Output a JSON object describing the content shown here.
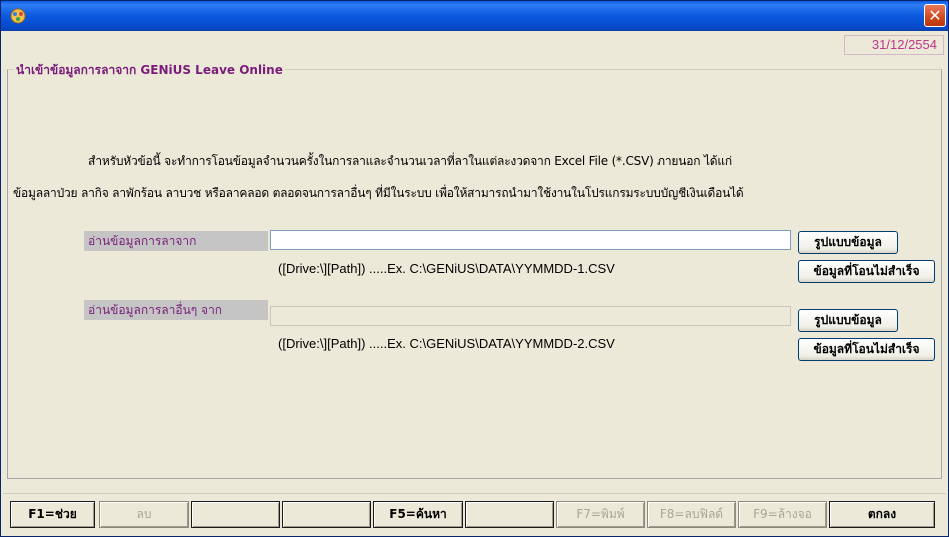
{
  "window": {
    "title": "",
    "title_bar_color": "#0a58de"
  },
  "date": "31/12/2554",
  "group": {
    "title": "นำเข้าข้อมูลการลาจาก GENiUS Leave Online"
  },
  "description": {
    "line1": "สำหรับหัวข้อนี้ จะทำการโอนข้อมูลจำนวนครั้งในการลาและจำนวนเวลาที่ลาในแต่ละงวดจาก Excel File (*.CSV) ภายนอก ได้แก่",
    "line2": "ข้อมูลลาป่วย ลากิจ ลาพักร้อน ลาบวช หรือลาคลอด ตลอดจนการลาอื่นๆ ที่มีในระบบ   เพื่อให้สามารถนำมาใช้งานในโปรแกรมระบบบัญชีเงินเดือนได้"
  },
  "leave_read": {
    "label": "อ่านข้อมูลการลาจาก",
    "value": "",
    "hint": "([Drive:\\][Path]) .....Ex. C:\\GENiUS\\DATA\\YYMMDD-1.CSV",
    "format_button": "รูปแบบข้อมูล",
    "failed_button": "ข้อมูลที่โอนไม่สำเร็จ"
  },
  "other_leave_read": {
    "label": "อ่านข้อมูลการลาอื่นๆ จาก",
    "value": "",
    "hint": "([Drive:\\][Path]) .....Ex. C:\\GENiUS\\DATA\\YYMMDD-2.CSV",
    "format_button": "รูปแบบข้อมูล",
    "failed_button": "ข้อมูลที่โอนไม่สำเร็จ"
  },
  "toolbar": {
    "f1": "F1=ช่วย",
    "delete": "ลบ",
    "blank1": "",
    "blank2": "",
    "f5": "F5=ค้นหา",
    "blank3": "",
    "f7": "F7=พิมพ์",
    "f8": "F8=ลบฟิลด์",
    "f9": "F9=ล้างจอ",
    "ok": "ตกลง"
  }
}
